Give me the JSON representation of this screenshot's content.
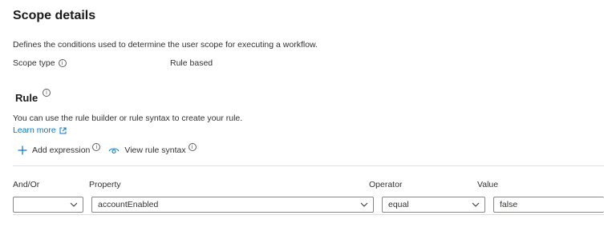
{
  "page": {
    "title": "Scope details",
    "description": "Defines the conditions used to determine the user scope for executing a workflow.",
    "scope_type_label": "Scope type",
    "scope_type_value": "Rule based"
  },
  "rule": {
    "title": "Rule",
    "description": "You can use the rule builder or rule syntax to create your rule.",
    "learn_more": "Learn more",
    "add_expression": "Add expression",
    "view_rule_syntax": "View rule syntax"
  },
  "table": {
    "headers": {
      "andor": "And/Or",
      "property": "Property",
      "operator": "Operator",
      "value": "Value"
    },
    "row": {
      "andor": "",
      "property": "accountEnabled",
      "operator": "equal",
      "value": "false"
    }
  },
  "icons": {
    "info": "info-icon",
    "external": "external-link-icon",
    "add": "plus-icon",
    "view": "eye-icon",
    "chevron": "chevron-down-icon"
  },
  "colors": {
    "link": "#0078d4",
    "border": "#8a8886",
    "separator": "#e1dfdd"
  }
}
